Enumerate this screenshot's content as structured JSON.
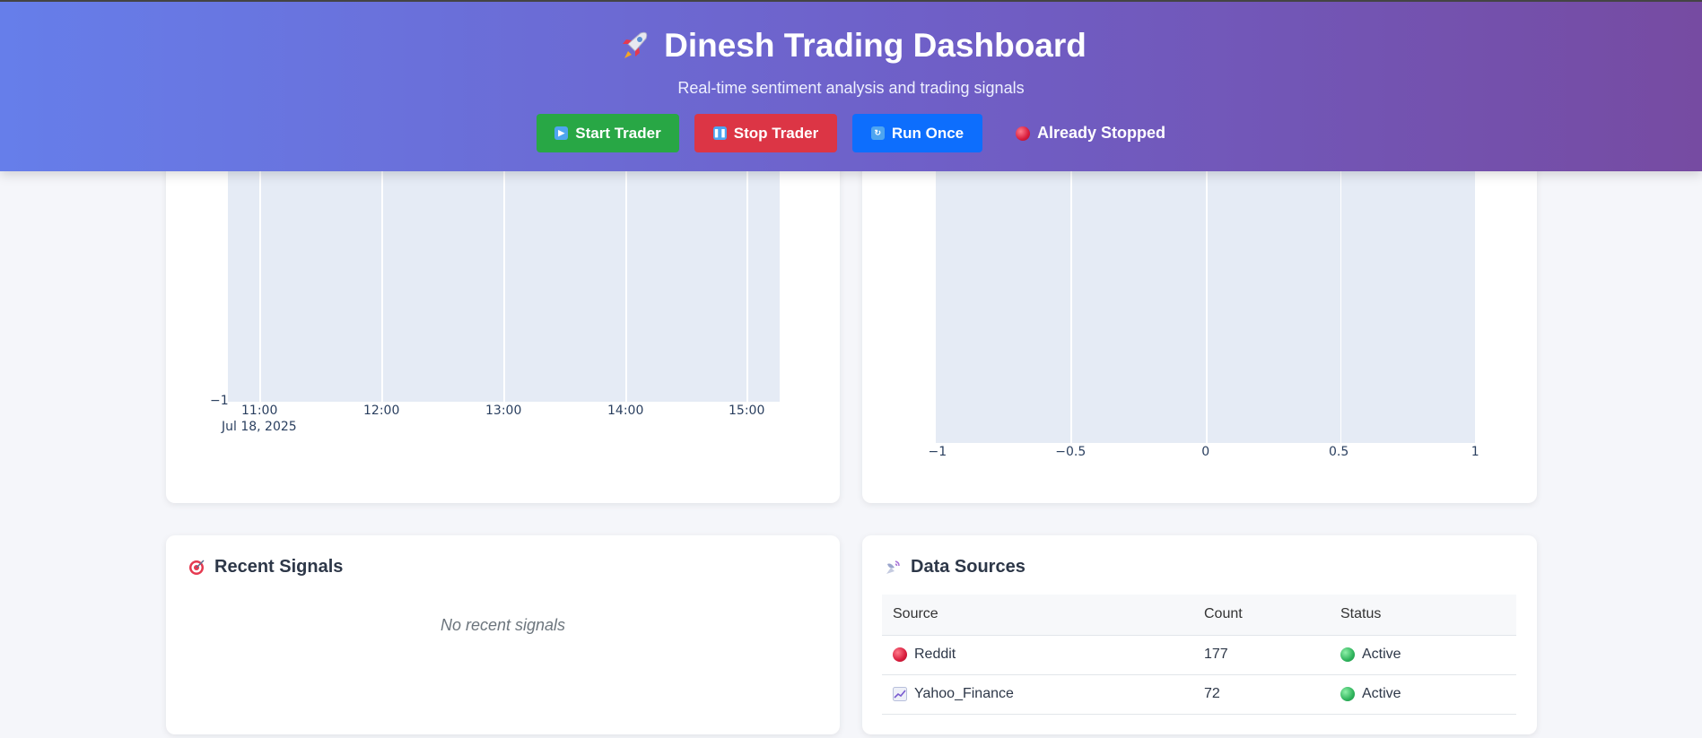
{
  "header": {
    "title": "Dinesh Trading Dashboard",
    "subtitle": "Real-time sentiment analysis and trading signals",
    "buttons": {
      "start": "Start Trader",
      "stop": "Stop Trader",
      "run": "Run Once"
    },
    "status": "Already Stopped",
    "colors": {
      "start": "#28a745",
      "stop": "#dc3545",
      "run": "#0d6efd"
    }
  },
  "chart_time": {
    "y_tick": "−1",
    "x_ticks": [
      "11:00",
      "12:00",
      "13:00",
      "14:00",
      "15:00"
    ],
    "x_date": "Jul 18, 2025"
  },
  "chart_dist": {
    "x_ticks": [
      "−1",
      "−0.5",
      "0",
      "0.5",
      "1"
    ]
  },
  "signals": {
    "title": "Recent Signals",
    "empty": "No recent signals"
  },
  "sources": {
    "title": "Data Sources",
    "columns": [
      "Source",
      "Count",
      "Status"
    ],
    "rows": [
      {
        "source": "Reddit",
        "count": "177",
        "status": "Active"
      },
      {
        "source": "Yahoo_Finance",
        "count": "72",
        "status": "Active"
      }
    ]
  },
  "chart_data": [
    {
      "type": "line",
      "title": "",
      "xlabel": "",
      "ylabel": "",
      "x_ticks": [
        "11:00",
        "12:00",
        "13:00",
        "14:00",
        "15:00"
      ],
      "x_tick_caption": "Jul 18, 2025",
      "y_ticks": [
        "−1"
      ],
      "series": [],
      "grid": true
    },
    {
      "type": "bar",
      "title": "",
      "xlabel": "",
      "ylabel": "",
      "xlim": [
        -1,
        1
      ],
      "x_ticks": [
        "−1",
        "−0.5",
        "0",
        "0.5",
        "1"
      ],
      "series": [],
      "grid": true
    }
  ]
}
